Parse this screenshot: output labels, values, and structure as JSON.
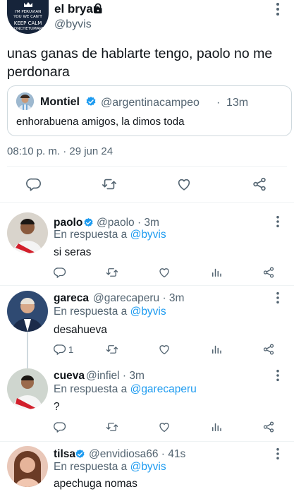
{
  "main_tweet": {
    "author_name": "el bryan",
    "author_handle": "@byvis",
    "avatar_lines": [
      "I'M PERUVIAN",
      "YOU WE CAN'T",
      "KEEP CALM",
      "CONCHETUMARE"
    ],
    "text": "unas ganas de hablarte tengo, paolo no me perdonara",
    "quoted": {
      "author_name": "Montiel",
      "author_handle": "@argentinacampeo",
      "separator": "·",
      "time": "13m",
      "text": "enhorabuena amigos, la dimos toda"
    },
    "timestamp": "08:10 p. m. · 29 jun 24"
  },
  "replies": [
    {
      "name": "paolo",
      "verified": true,
      "handle_time": "@paolo · 3m",
      "reply_prefix": "En respuesta a",
      "reply_to": "@byvis",
      "text": "si seras",
      "reply_count": ""
    },
    {
      "name": "gareca",
      "verified": false,
      "handle_time": "@garecaperu · 3m",
      "reply_prefix": "En respuesta a",
      "reply_to": "@byvis",
      "text": "desahueva",
      "reply_count": "1"
    },
    {
      "name": "cueva",
      "verified": false,
      "handle_time": "@infiel · 3m",
      "reply_prefix": "En respuesta a",
      "reply_to": "@garecaperu",
      "text": "?",
      "reply_count": ""
    },
    {
      "name": "tilsa",
      "verified": true,
      "handle_time": "@envidiosa66 · 41s",
      "reply_prefix": "En respuesta a",
      "reply_to": "@byvis",
      "text": "apechuga nomas",
      "reply_count": ""
    }
  ],
  "icons": [
    "lock-icon",
    "more-icon",
    "verified-icon",
    "reply-icon",
    "retweet-icon",
    "like-icon",
    "views-icon",
    "share-icon"
  ],
  "colors": {
    "accent": "#1d9bf0",
    "text": "#0f1419",
    "muted": "#536471",
    "divider": "#eff3f4"
  }
}
